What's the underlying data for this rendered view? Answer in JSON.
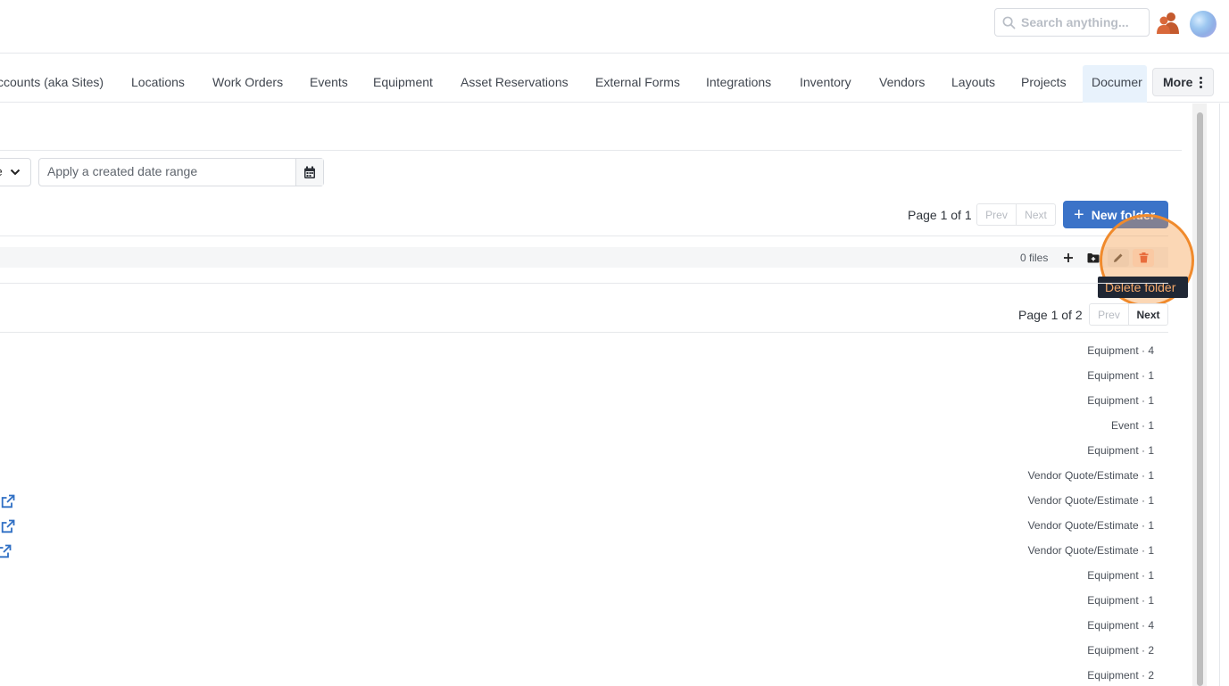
{
  "header": {
    "search_placeholder": "Search anything...",
    "icons": {
      "search": "search-icon",
      "users": "users-icon",
      "avatar": "avatar"
    },
    "accent_color": "#3b73c8"
  },
  "nav": {
    "items": [
      {
        "label": "ccounts (aka Sites)"
      },
      {
        "label": "Locations"
      },
      {
        "label": "Work Orders"
      },
      {
        "label": "Events"
      },
      {
        "label": "Equipment"
      },
      {
        "label": "Asset Reservations"
      },
      {
        "label": "External Forms"
      },
      {
        "label": "Integrations"
      },
      {
        "label": "Inventory"
      },
      {
        "label": "Vendors"
      },
      {
        "label": "Layouts"
      },
      {
        "label": "Projects"
      },
      {
        "label": "Documer",
        "active": true
      }
    ],
    "more_label": "More"
  },
  "filters": {
    "select_value_fragment": "e",
    "date_range_placeholder": "Apply a created date range"
  },
  "folders_pager": {
    "page_text": "Page 1 of 1",
    "prev_label": "Prev",
    "next_label": "Next",
    "new_folder_label": "New folder"
  },
  "folder_row": {
    "files_count": "0 files",
    "tooltip": "Delete folder"
  },
  "files_pager": {
    "page_text": "Page 1 of 2",
    "prev_label": "Prev",
    "next_label": "Next"
  },
  "files": [
    {
      "label": "Equipment · 4",
      "external_link": false
    },
    {
      "label": "Equipment · 1",
      "external_link": false
    },
    {
      "label": "Equipment · 1",
      "external_link": false
    },
    {
      "label": "Event · 1",
      "external_link": false
    },
    {
      "label": "Equipment · 1",
      "external_link": false
    },
    {
      "label": "Vendor Quote/Estimate · 1",
      "external_link": false
    },
    {
      "label": "Vendor Quote/Estimate · 1",
      "external_link": true
    },
    {
      "label": "Vendor Quote/Estimate · 1",
      "external_link": true
    },
    {
      "label": "Vendor Quote/Estimate · 1",
      "external_link": true
    },
    {
      "label": "Equipment · 1",
      "external_link": false
    },
    {
      "label": "Equipment · 1",
      "external_link": false
    },
    {
      "label": "Equipment · 4",
      "external_link": false
    },
    {
      "label": "Equipment · 2",
      "external_link": false
    },
    {
      "label": "Equipment · 2",
      "external_link": false
    }
  ]
}
